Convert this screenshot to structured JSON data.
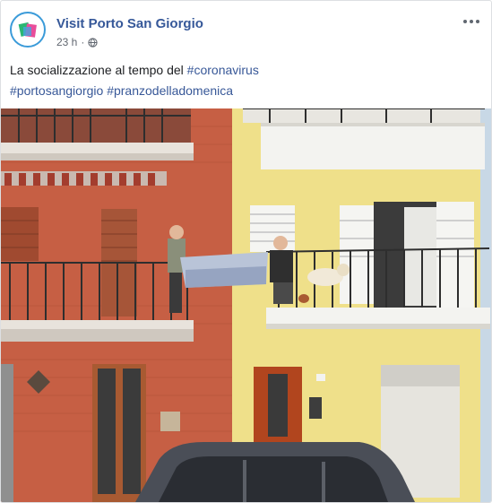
{
  "post": {
    "page_name": "Visit Porto San Giorgio",
    "time": "23 h",
    "separator": "·",
    "audience_icon": "globe-icon",
    "more_icon": "more-options-icon",
    "text_plain": "La socializzazione al tempo del ",
    "hashtags": [
      "#coronavirus",
      "#portosangiorgio",
      "#pranzodelladomenica"
    ],
    "photo_description_icon": "photo-balcony-scene"
  },
  "colors": {
    "link": "#365899",
    "hashtag": "#385898",
    "text": "#1c1e21",
    "meta": "#616770",
    "brick": "#c65f44",
    "yellow_wall": "#efe08a",
    "sky": "#c8d8e6"
  }
}
